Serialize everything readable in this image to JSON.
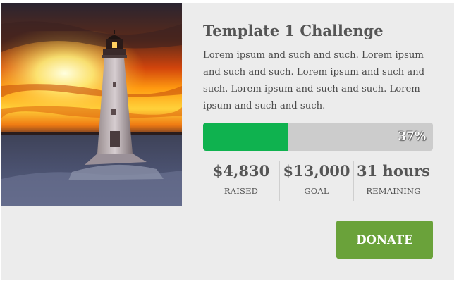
{
  "campaign": {
    "title": "Template 1 Challenge",
    "description": "Lorem ipsum and such and such. Lorem ipsum and such and such. Lorem ipsum and such and such. Lorem ipsum and such and such. Lorem ipsum and such and such.",
    "image_alt_icon": "lighthouse-photo",
    "progress": {
      "percent": 37,
      "label": "37%",
      "fill_color": "#0fb24f",
      "track_color": "#cccccc"
    },
    "stats": [
      {
        "value": "$4,830",
        "label": "RAISED"
      },
      {
        "value": "$13,000",
        "label": "GOAL"
      },
      {
        "value": "31 hours",
        "label": "REMAINING"
      }
    ],
    "donate_label": "DONATE",
    "donate_color": "#6aa23a"
  }
}
